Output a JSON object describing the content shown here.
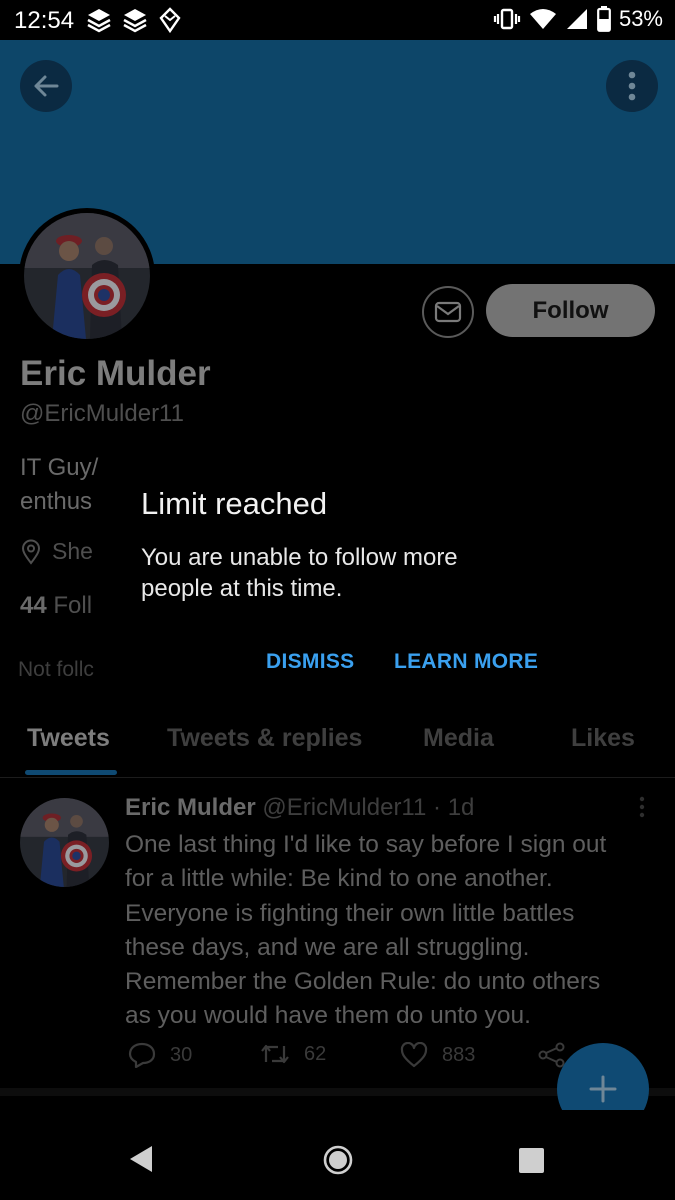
{
  "status_bar": {
    "time": "12:54",
    "battery": "53%"
  },
  "profile": {
    "name": "Eric Mulder",
    "handle": "@EricMulder11",
    "bio_line_1": "IT Guy/",
    "bio_line_2": "enthus",
    "location": "She",
    "following_count": "44",
    "following_label": "Foll",
    "not_followed": "Not follc",
    "follow_label": "Follow",
    "banner_color": "#0d4669"
  },
  "tabs": [
    {
      "label": "Tweets",
      "active": true
    },
    {
      "label": "Tweets & replies",
      "active": false
    },
    {
      "label": "Media",
      "active": false
    },
    {
      "label": "Likes",
      "active": false
    }
  ],
  "tweet": {
    "name": "Eric Mulder",
    "handle": "@EricMulder11",
    "separator": "·",
    "time": "1d",
    "text_lines": [
      "One last thing I'd like to say before I sign out",
      "for a little while: Be kind to one another.",
      "Everyone is fighting their own little battles",
      "these days, and we are all struggling.",
      "Remember the Golden Rule: do unto others",
      "as you would have them do unto you."
    ],
    "replies": "30",
    "retweets": "62",
    "likes": "883"
  },
  "dialog": {
    "title": "Limit reached",
    "message_lines": [
      "You are unable to follow more",
      "people at this time."
    ],
    "dismiss_label": "DISMISS",
    "learn_more_label": "LEARN MORE",
    "accent_color": "#3aa0ef"
  },
  "icons": {
    "back": "arrow-left-icon",
    "more": "more-vertical-icon",
    "message": "mail-icon",
    "location": "location-pin-icon",
    "reply": "reply-icon",
    "retweet": "retweet-icon",
    "like": "heart-icon",
    "share": "share-icon",
    "compose": "plus-icon"
  }
}
